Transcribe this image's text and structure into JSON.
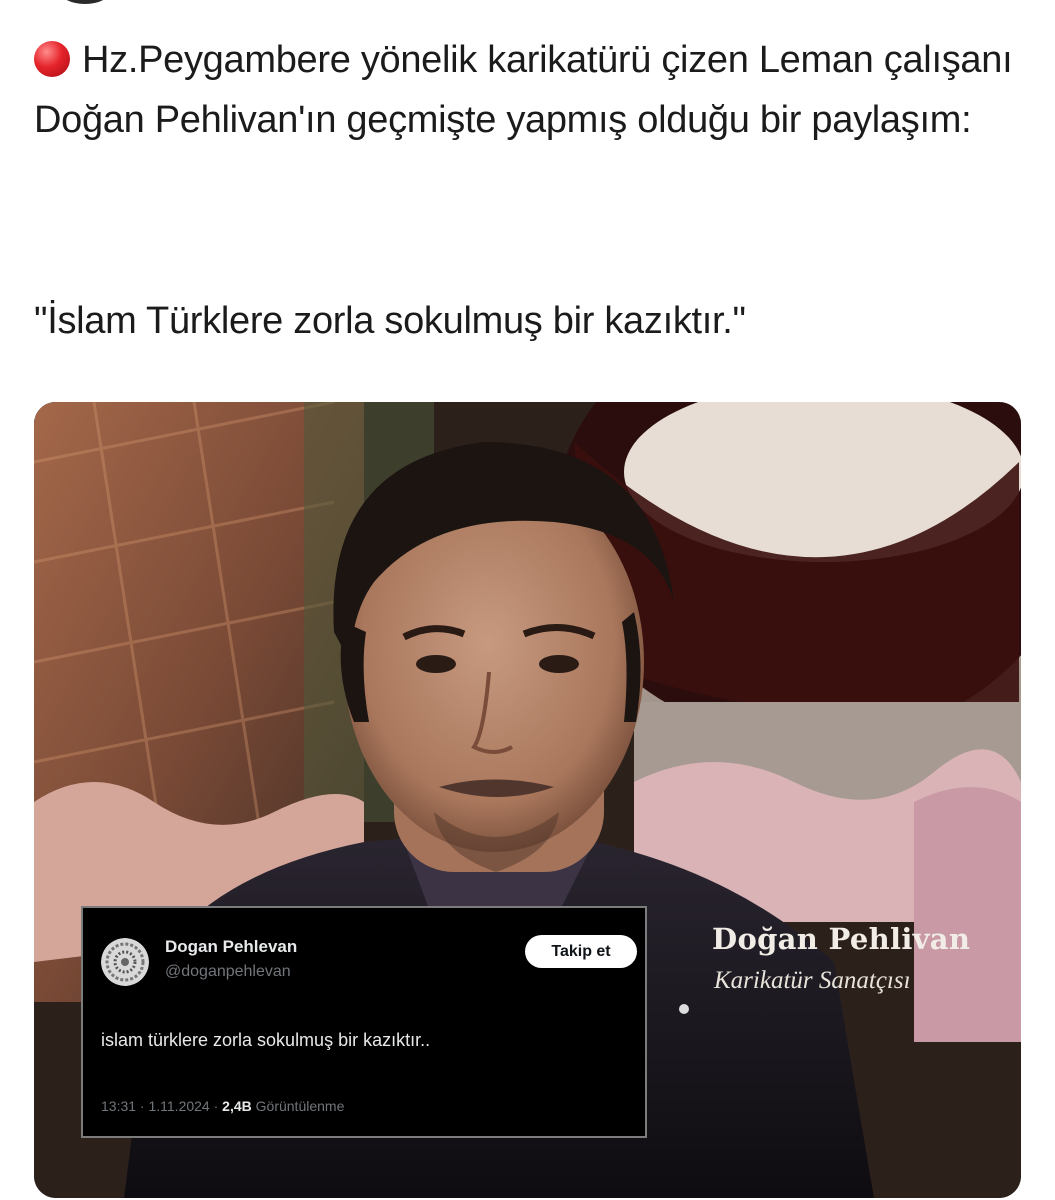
{
  "post": {
    "headline": "Hz.Peygambere yönelik karikatürü çizen Leman çalışanı Doğan Pehlivan'ın geçmişte yapmış olduğu bir paylaşım:",
    "quote": "\"İslam Türklere zorla sokulmuş bir kazıktır.\"",
    "indicator_color": "#e5232a",
    "indicator_icon": "red-circle-icon"
  },
  "media": {
    "caption_name": "Doğan Pehlivan",
    "caption_role": "Karikatür Sanatçısı",
    "embedded_tweet": {
      "display_name": "Dogan Pehlevan",
      "handle": "@doganpehlevan",
      "follow_label": "Takip et",
      "text": "islam türklere zorla sokulmuş bir kazıktır..",
      "timestamp": "13:31 · 1.11.2024 ·",
      "views_count": "2,4B",
      "views_label": "Görüntülenme"
    }
  }
}
